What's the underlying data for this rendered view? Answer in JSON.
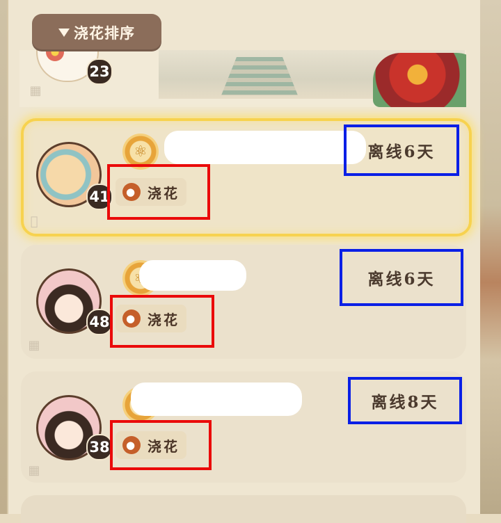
{
  "header": {
    "sort_label": "浇花排序"
  },
  "top_card": {
    "level": "23"
  },
  "cards": [
    {
      "level": "41",
      "water_label": "浇花",
      "offline_text": "离线6天",
      "platform": "apple",
      "highlighted": true
    },
    {
      "level": "48",
      "water_label": "浇花",
      "offline_text": "离线6天",
      "platform": "android",
      "highlighted": false
    },
    {
      "level": "38",
      "water_label": "浇花",
      "offline_text": "离线8天",
      "platform": "android",
      "highlighted": false
    }
  ],
  "colors": {
    "highlight_border": "#f7d24f",
    "annotation_red": "#ea0a0a",
    "annotation_blue": "#0a1fe6",
    "level_badge": "#3a2a22"
  },
  "icons": {
    "sort": "triangle-down-icon",
    "water": "watering-can-icon",
    "apple": "apple-icon",
    "android": "android-icon"
  }
}
